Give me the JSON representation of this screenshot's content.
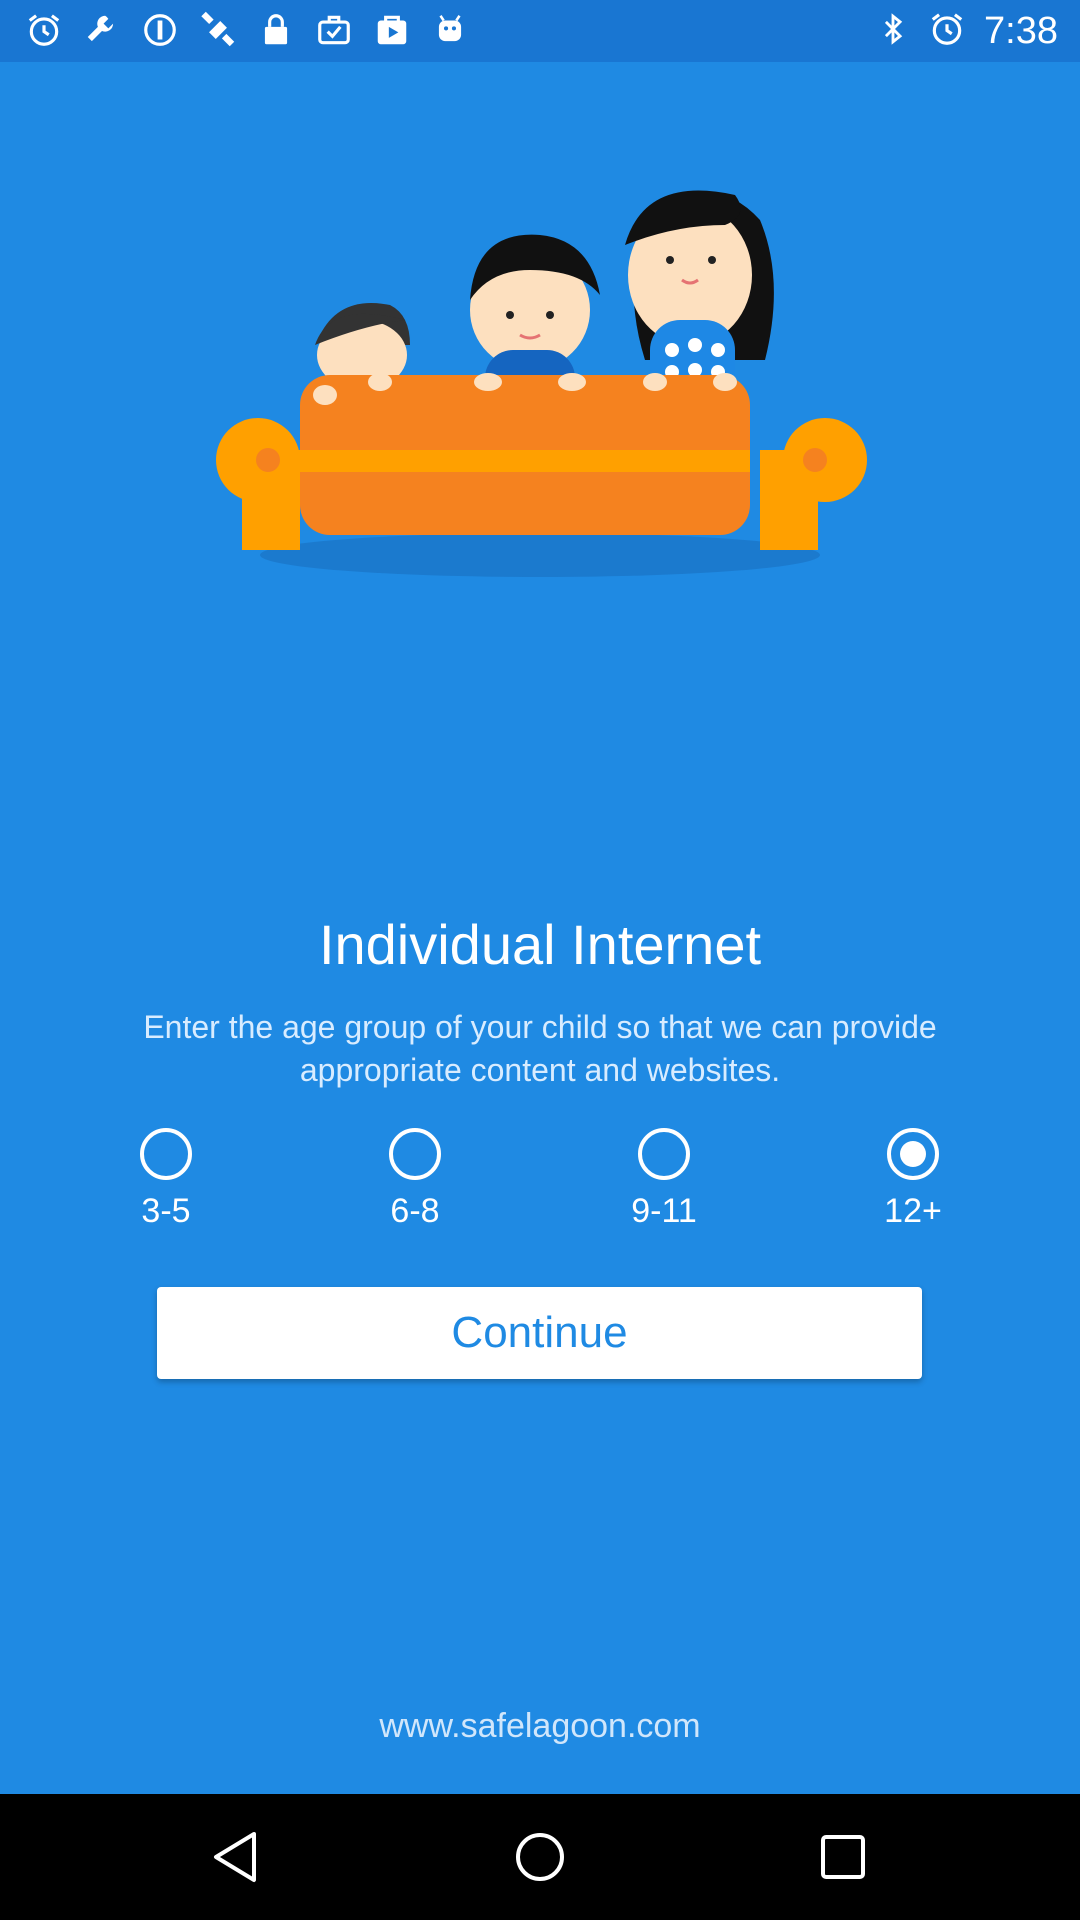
{
  "status_bar": {
    "time": "7:38",
    "left_icons": [
      "alarm-icon",
      "wrench-icon",
      "info-icon",
      "satellite-icon",
      "lock-icon",
      "briefcase-check-icon",
      "play-store-icon",
      "android-icon"
    ],
    "right_icons": [
      "bluetooth-icon",
      "alarm-icon"
    ]
  },
  "main": {
    "title": "Individual Internet",
    "subtitle": "Enter the age group of your child so that we can provide appropriate content and websites.",
    "age_groups": [
      {
        "label": "3-5",
        "checked": false
      },
      {
        "label": "6-8",
        "checked": false
      },
      {
        "label": "9-11",
        "checked": false
      },
      {
        "label": "12+",
        "checked": true
      }
    ],
    "continue_label": "Continue",
    "footer": "www.safelagoon.com"
  },
  "colors": {
    "background": "#1f8ae3",
    "button_text": "#1f8ae3",
    "sofa_orange": "#f5821f",
    "sofa_arm": "#ffa000"
  },
  "nav_bar": {
    "buttons": [
      "back-icon",
      "home-icon",
      "recents-icon"
    ]
  }
}
